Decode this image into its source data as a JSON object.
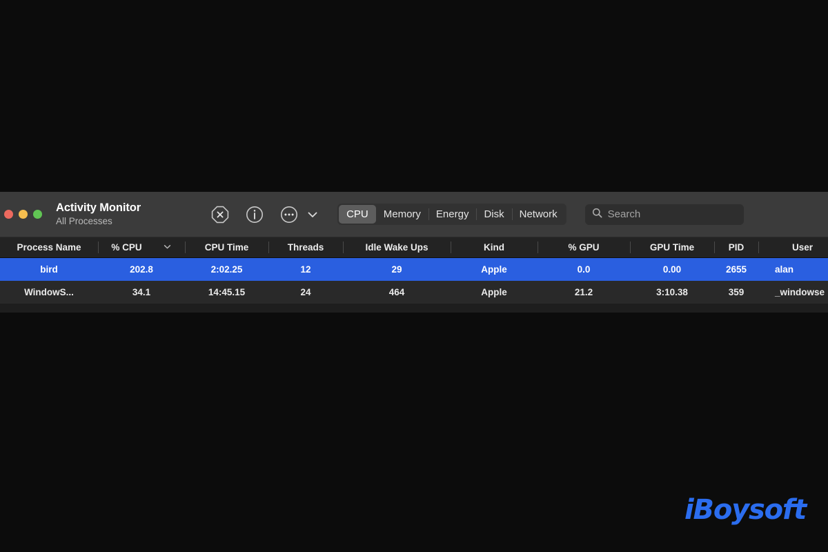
{
  "window": {
    "title": "Activity Monitor",
    "subtitle": "All Processes"
  },
  "toolbar": {
    "quit_process_icon": "octagon-x-icon",
    "inspect_icon": "info-circle-icon",
    "options_icon": "ellipsis-circle-icon",
    "options_chevron_icon": "chevron-down-icon",
    "tabs": [
      {
        "label": "CPU",
        "active": true
      },
      {
        "label": "Memory",
        "active": false
      },
      {
        "label": "Energy",
        "active": false
      },
      {
        "label": "Disk",
        "active": false
      },
      {
        "label": "Network",
        "active": false
      }
    ],
    "search": {
      "icon": "search-icon",
      "placeholder": "Search",
      "value": ""
    }
  },
  "table": {
    "columns": [
      {
        "key": "process_name",
        "label": "Process Name",
        "sorted": false
      },
      {
        "key": "cpu_percent",
        "label": "% CPU",
        "sorted": true,
        "sort_icon": "chevron-down-icon"
      },
      {
        "key": "cpu_time",
        "label": "CPU Time",
        "sorted": false
      },
      {
        "key": "threads",
        "label": "Threads",
        "sorted": false
      },
      {
        "key": "idle_wake_ups",
        "label": "Idle Wake Ups",
        "sorted": false
      },
      {
        "key": "kind",
        "label": "Kind",
        "sorted": false
      },
      {
        "key": "gpu_percent",
        "label": "% GPU",
        "sorted": false
      },
      {
        "key": "gpu_time",
        "label": "GPU Time",
        "sorted": false
      },
      {
        "key": "pid",
        "label": "PID",
        "sorted": false
      },
      {
        "key": "user",
        "label": "User",
        "sorted": false
      }
    ],
    "rows": [
      {
        "selected": true,
        "process_name": "bird",
        "cpu_percent": "202.8",
        "cpu_time": "2:02.25",
        "threads": "12",
        "idle_wake_ups": "29",
        "kind": "Apple",
        "gpu_percent": "0.0",
        "gpu_time": "0.00",
        "pid": "2655",
        "user": "alan"
      },
      {
        "selected": false,
        "process_name": "WindowS...",
        "cpu_percent": "34.1",
        "cpu_time": "14:45.15",
        "threads": "24",
        "idle_wake_ups": "464",
        "kind": "Apple",
        "gpu_percent": "21.2",
        "gpu_time": "3:10.38",
        "pid": "359",
        "user": "_windowse"
      }
    ]
  },
  "watermark": {
    "text": "iBoysoft"
  },
  "colors": {
    "accent_selection": "#2a5fe0",
    "toolbar_bg": "#3b3b3b",
    "header_bg": "#232323",
    "row_alt_bg": "#292929",
    "desktop_bg": "#0c0c0c",
    "watermark_blue": "#2b6def",
    "traffic_red": "#ed6a5f",
    "traffic_yellow": "#f5be4f",
    "traffic_green": "#61c554"
  }
}
